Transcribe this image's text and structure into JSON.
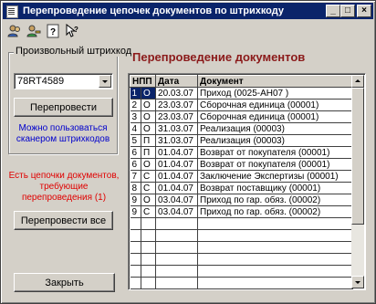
{
  "window": {
    "title": "Перепроведение цепочек документов по штрихкоду",
    "minimize_label": "_",
    "maximize_label": "□",
    "close_label": "×"
  },
  "toolbar": {
    "icons": [
      "users-icon",
      "user-key-icon",
      "help-icon",
      "pointer-help-icon"
    ]
  },
  "left_panel": {
    "group_label": "Произвольный штрихкод",
    "barcode_value": "78RT4589",
    "repost_button": "Перепровести",
    "scanner_hint": "Можно пользоваться сканером штрихкодов",
    "chains_warning": "Есть цепочки документов, требующие перепроведения (1)",
    "repost_all_button": "Перепровести все",
    "close_button": "Закрыть"
  },
  "main": {
    "heading": "Перепроведение документов",
    "columns": [
      "НПП",
      "",
      "Дата",
      "Документ"
    ],
    "rows": [
      {
        "n": "1",
        "s": "О",
        "date": "20.03.07",
        "doc": "Приход (0025-АН07 )",
        "selected": true
      },
      {
        "n": "2",
        "s": "О",
        "date": "23.03.07",
        "doc": "Сборочная единица (00001)"
      },
      {
        "n": "3",
        "s": "О",
        "date": "23.03.07",
        "doc": "Сборочная единица (00001)"
      },
      {
        "n": "4",
        "s": "О",
        "date": "31.03.07",
        "doc": "Реализация (00003)"
      },
      {
        "n": "5",
        "s": "П",
        "date": "31.03.07",
        "doc": "Реализация (00003)"
      },
      {
        "n": "6",
        "s": "П",
        "date": "01.04.07",
        "doc": "Возврат от покупателя (00001)"
      },
      {
        "n": "6",
        "s": "О",
        "date": "01.04.07",
        "doc": "Возврат от покупателя (00001)"
      },
      {
        "n": "7",
        "s": "С",
        "date": "01.04.07",
        "doc": "Заключение Экспертизы (00001)"
      },
      {
        "n": "8",
        "s": "С",
        "date": "01.04.07",
        "doc": "Возврат поставщику (00001)"
      },
      {
        "n": "9",
        "s": "О",
        "date": "03.04.07",
        "doc": "Приход по гар. обяз. (00002)"
      },
      {
        "n": "9",
        "s": "С",
        "date": "03.04.07",
        "doc": "Приход по гар. обяз. (00002)"
      }
    ],
    "empty_rows": 6
  }
}
